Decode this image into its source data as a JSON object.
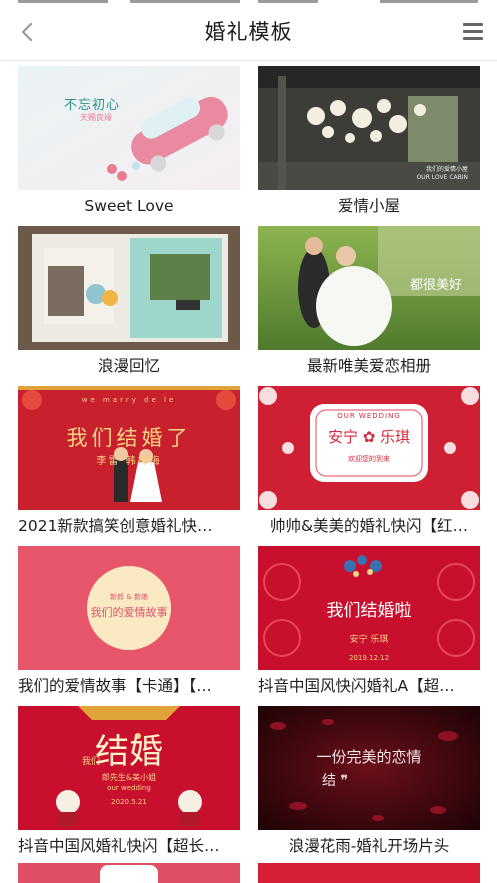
{
  "header": {
    "title": "婚礼模板",
    "back_icon": "chevron-left-icon",
    "menu_icon": "menu-icon"
  },
  "templates": [
    {
      "caption": "Sweet Love",
      "thumb_text": "不忘初心",
      "thumb_sub": "天赐良缘"
    },
    {
      "caption": "爱情小屋",
      "thumb_text": "我们的爱情小屋",
      "thumb_sub": "OUR LOVE CABIN"
    },
    {
      "caption": "浪漫回忆"
    },
    {
      "caption": "最新唯美爱恋相册",
      "thumb_text": "都很美好"
    },
    {
      "caption": "2021新款搞笑创意婚礼快…",
      "thumb_text": "我们结婚了",
      "thumb_sub": "李雷 韩梅梅",
      "thumb_top": "we  marry  de  le"
    },
    {
      "caption": "帅帅&美美的婚礼快闪【红…",
      "thumb_text": "安宁 ✿ 乐琪",
      "thumb_sub": "欢迎您的到来",
      "thumb_top": "OUR WEDDING"
    },
    {
      "caption": "我们的爱情故事【卡通】【…",
      "thumb_text": "我们的爱情故事",
      "thumb_sub": "新郎 & 新娘"
    },
    {
      "caption": "抖音中国风快闪婚礼A【超…",
      "thumb_text": "我们结婚啦",
      "thumb_sub": "安宁    乐琪",
      "thumb_date": "2019.12.12"
    },
    {
      "caption": "抖音中国风婚礼快闪【超长…",
      "thumb_text": "结婚",
      "thumb_sub": "我们",
      "thumb_names": "郎先生&美小姐",
      "thumb_en": "our wedding",
      "thumb_date": "2020.5.21"
    },
    {
      "caption": "浪漫花雨-婚礼开场片头",
      "thumb_text": "一份完美的恋情",
      "thumb_sub": "结 ❞"
    }
  ],
  "colors": {
    "wedding_red": "#c8102e",
    "pink": "#e8566c",
    "text": "#1f1f1f",
    "divider": "#e6e6e6"
  }
}
